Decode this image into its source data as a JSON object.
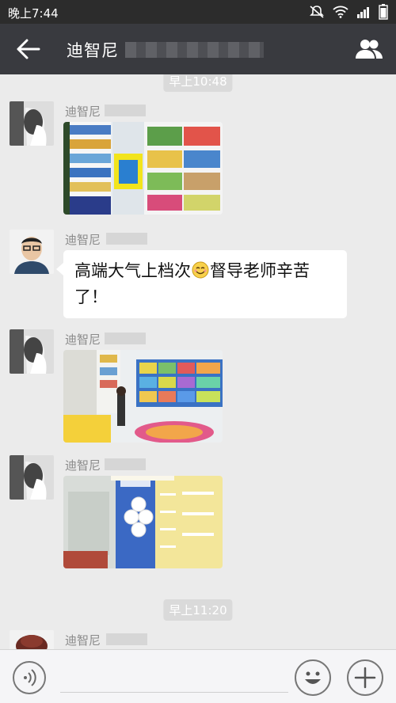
{
  "status_bar": {
    "time": "晚上7:44",
    "icons": [
      "notification-off-icon",
      "wifi-icon",
      "signal-icon",
      "battery-icon"
    ]
  },
  "header": {
    "title": "迪智尼",
    "back_icon": "back-arrow-icon",
    "members_icon": "group-members-icon"
  },
  "timestamps": [
    "早上10:48",
    "早上11:20"
  ],
  "messages": [
    {
      "sender": "迪智尼",
      "type": "image",
      "image_desc": "toy-shelf-photo"
    },
    {
      "sender": "迪智尼",
      "type": "text",
      "text_before": "高端大气上档次",
      "emoji": "smiley-emoji",
      "text_after": "督导老师辛苦了！"
    },
    {
      "sender": "迪智尼",
      "type": "image",
      "image_desc": "toy-store-interior-photo"
    },
    {
      "sender": "迪智尼",
      "type": "image",
      "image_desc": "blue-wall-display-photo"
    },
    {
      "sender": "迪智尼",
      "type": "text",
      "text_before": "",
      "emoji": "",
      "text_after": ""
    }
  ],
  "input_bar": {
    "voice_icon": "voice-icon",
    "emoji_icon": "emoji-icon",
    "plus_icon": "plus-icon"
  },
  "colors": {
    "header_bg": "#393a3f",
    "status_bg": "#2c2c2c",
    "chat_bg": "#ebebeb",
    "timestamp_bg": "#dadada"
  }
}
